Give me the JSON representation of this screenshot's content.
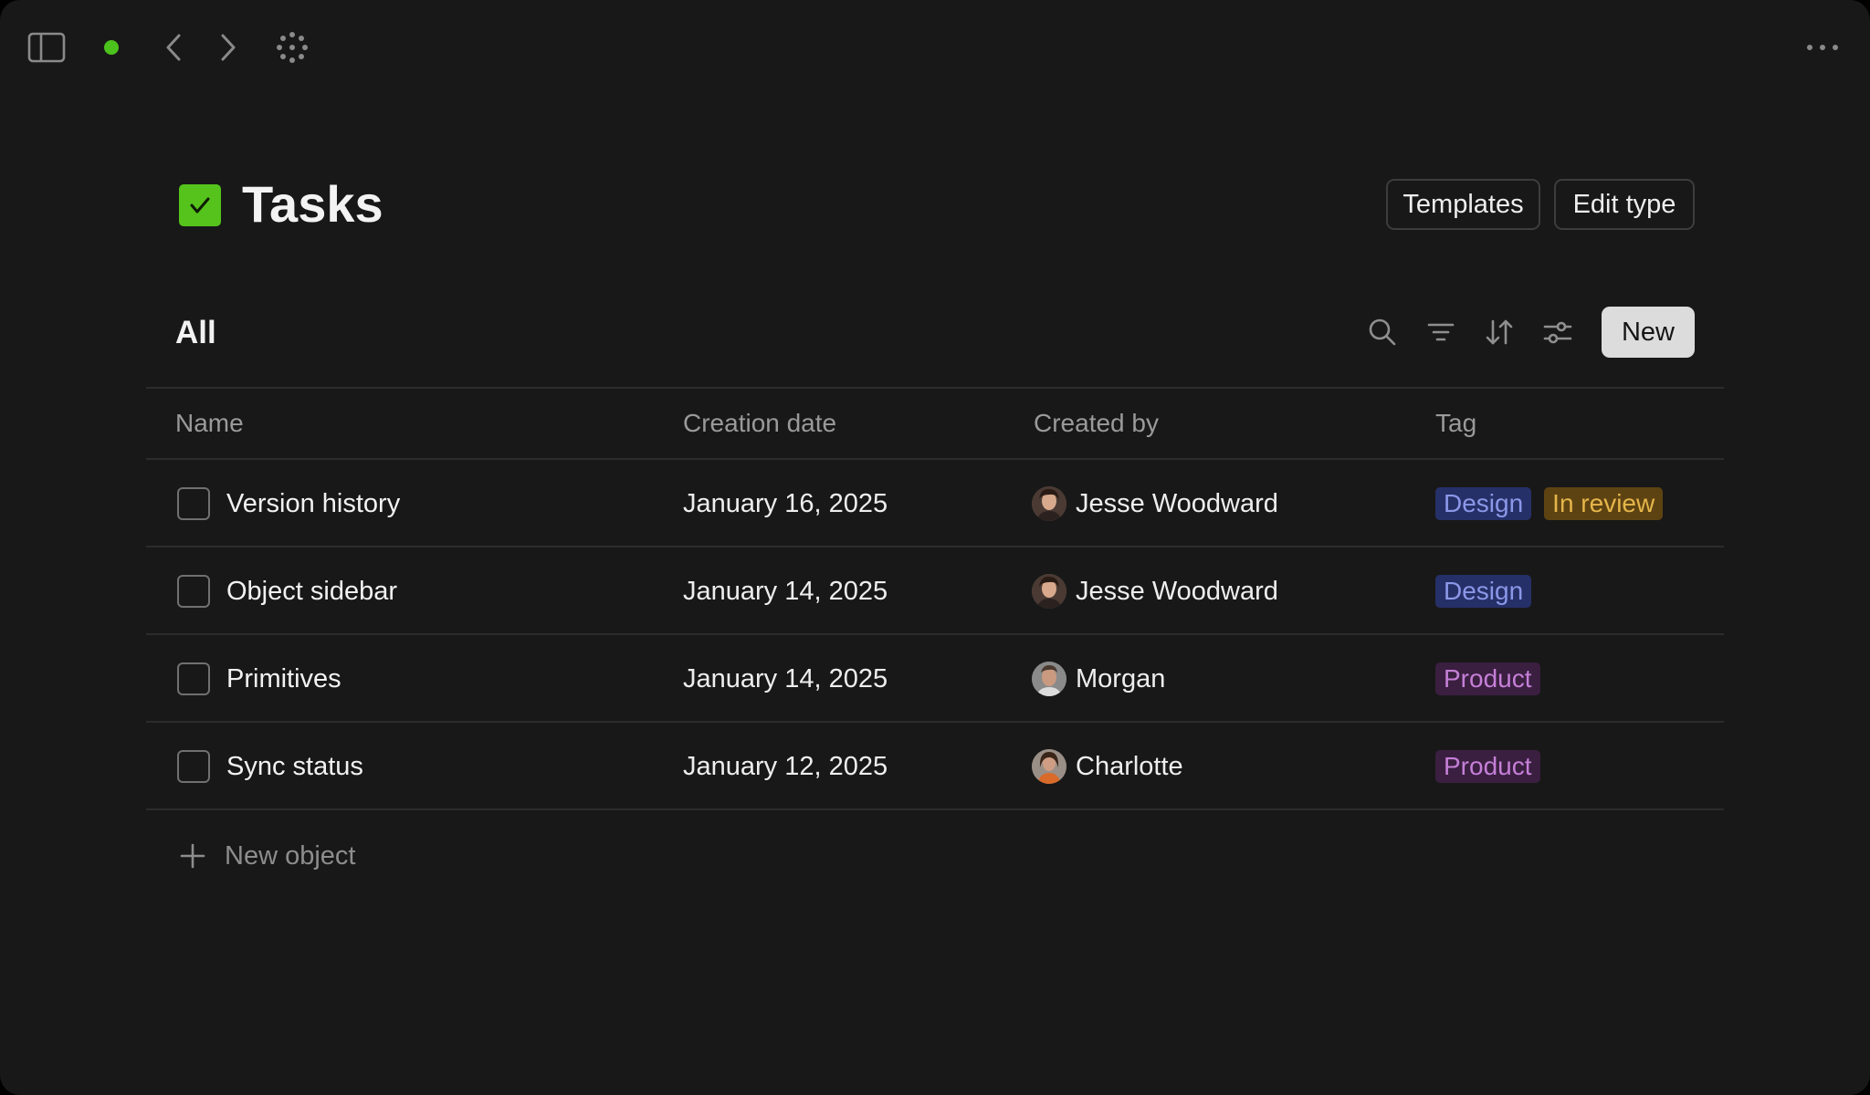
{
  "topbar": {
    "sidebar_icon": "sidebar-toggle-icon",
    "status_color": "#4cc21c",
    "back_icon": "chevron-left-icon",
    "forward_icon": "chevron-right-icon",
    "loader_icon": "loading-spinner-icon",
    "more_icon": "more-horizontal-icon"
  },
  "header": {
    "title": "Tasks",
    "type_icon": "checkbox-checked-icon",
    "type_icon_color": "#55c31b",
    "templates_label": "Templates",
    "edit_type_label": "Edit type"
  },
  "view": {
    "title": "All",
    "tools": [
      "search-icon",
      "filter-icon",
      "sort-icon",
      "settings-sliders-icon"
    ],
    "new_label": "New"
  },
  "table": {
    "columns": [
      "Name",
      "Creation date",
      "Created by",
      "Tag"
    ],
    "rows": [
      {
        "name": "Version history",
        "date": "January 16, 2025",
        "creator": "Jesse Woodward",
        "tags": [
          {
            "label": "Design",
            "kind": "design"
          },
          {
            "label": "In review",
            "kind": "review"
          }
        ]
      },
      {
        "name": "Object sidebar",
        "date": "January 14, 2025",
        "creator": "Jesse Woodward",
        "tags": [
          {
            "label": "Design",
            "kind": "design"
          }
        ]
      },
      {
        "name": "Primitives",
        "date": "January 14, 2025",
        "creator": "Morgan",
        "tags": [
          {
            "label": "Product",
            "kind": "product"
          }
        ]
      },
      {
        "name": "Sync status",
        "date": "January 12, 2025",
        "creator": "Charlotte",
        "tags": [
          {
            "label": "Product",
            "kind": "product"
          }
        ]
      }
    ],
    "new_object_label": "New object"
  },
  "colors": {
    "background": "#181818",
    "design_tag_bg": "#263068",
    "design_tag_fg": "#8b97e8",
    "review_tag_bg": "#5e4312",
    "review_tag_fg": "#e5b64a",
    "product_tag_bg": "#3a1f40",
    "product_tag_fg": "#c57fd7"
  }
}
